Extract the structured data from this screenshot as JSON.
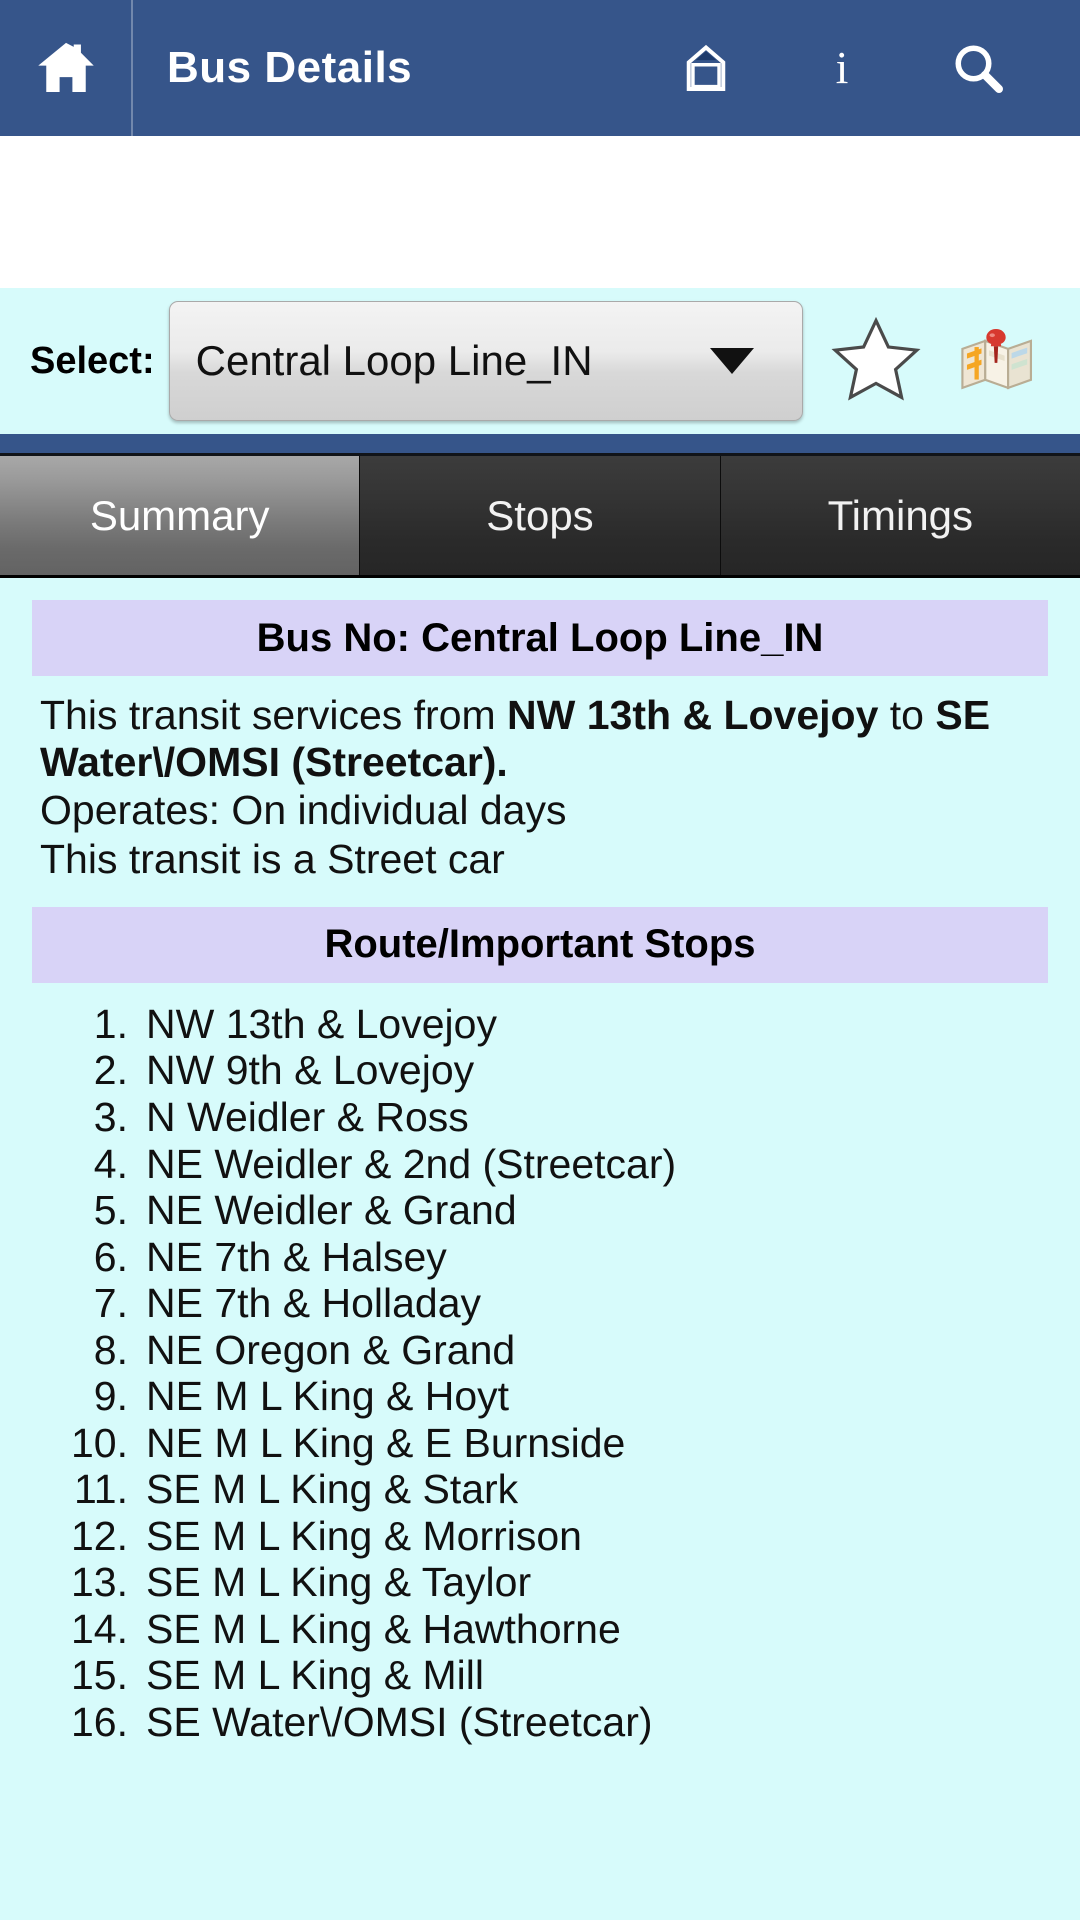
{
  "actionbar": {
    "title": "Bus Details",
    "home_icon": "home-icon",
    "secondary_home_icon": "home-outline-icon",
    "info_icon": "info-icon",
    "info_glyph": "i",
    "search_icon": "search-icon",
    "background_color": "#36558a"
  },
  "select": {
    "label": "Select:",
    "value": "Central Loop Line_IN",
    "caret_icon": "chevron-down-icon",
    "favorite_icon": "star-outline-icon",
    "map_icon": "map-pin-icon",
    "background_color": "#d7fbfb"
  },
  "tabs": [
    {
      "label": "Summary",
      "active": true
    },
    {
      "label": "Stops",
      "active": false
    },
    {
      "label": "Timings",
      "active": false
    }
  ],
  "summary": {
    "bus_no_header": "Bus No: Central Loop Line_IN",
    "desc_prefix": "This transit services from ",
    "desc_origin": "NW 13th & Lovejoy",
    "desc_middle": " to ",
    "desc_destination": "SE Water\\/OMSI (Streetcar).",
    "operates": "Operates: On individual days",
    "transit_type": "This transit is a Street car",
    "route_header": "Route/Important Stops",
    "band_color": "#d8d3f7",
    "stops": [
      {
        "num": "1.",
        "name": "NW 13th & Lovejoy"
      },
      {
        "num": "2.",
        "name": "NW 9th & Lovejoy"
      },
      {
        "num": "3.",
        "name": "N Weidler & Ross"
      },
      {
        "num": "4.",
        "name": "NE Weidler & 2nd (Streetcar)"
      },
      {
        "num": "5.",
        "name": "NE Weidler & Grand"
      },
      {
        "num": "6.",
        "name": "NE 7th & Halsey"
      },
      {
        "num": "7.",
        "name": "NE 7th & Holladay"
      },
      {
        "num": "8.",
        "name": "NE Oregon & Grand"
      },
      {
        "num": "9.",
        "name": "NE M L King & Hoyt"
      },
      {
        "num": "10.",
        "name": "NE M L King & E Burnside"
      },
      {
        "num": "11.",
        "name": "SE M L King & Stark"
      },
      {
        "num": "12.",
        "name": "SE M L King & Morrison"
      },
      {
        "num": "13.",
        "name": "SE M L King & Taylor"
      },
      {
        "num": "14.",
        "name": "SE M L King & Hawthorne"
      },
      {
        "num": "15.",
        "name": "SE M L King & Mill"
      },
      {
        "num": "16.",
        "name": "SE Water\\/OMSI (Streetcar)"
      }
    ]
  }
}
